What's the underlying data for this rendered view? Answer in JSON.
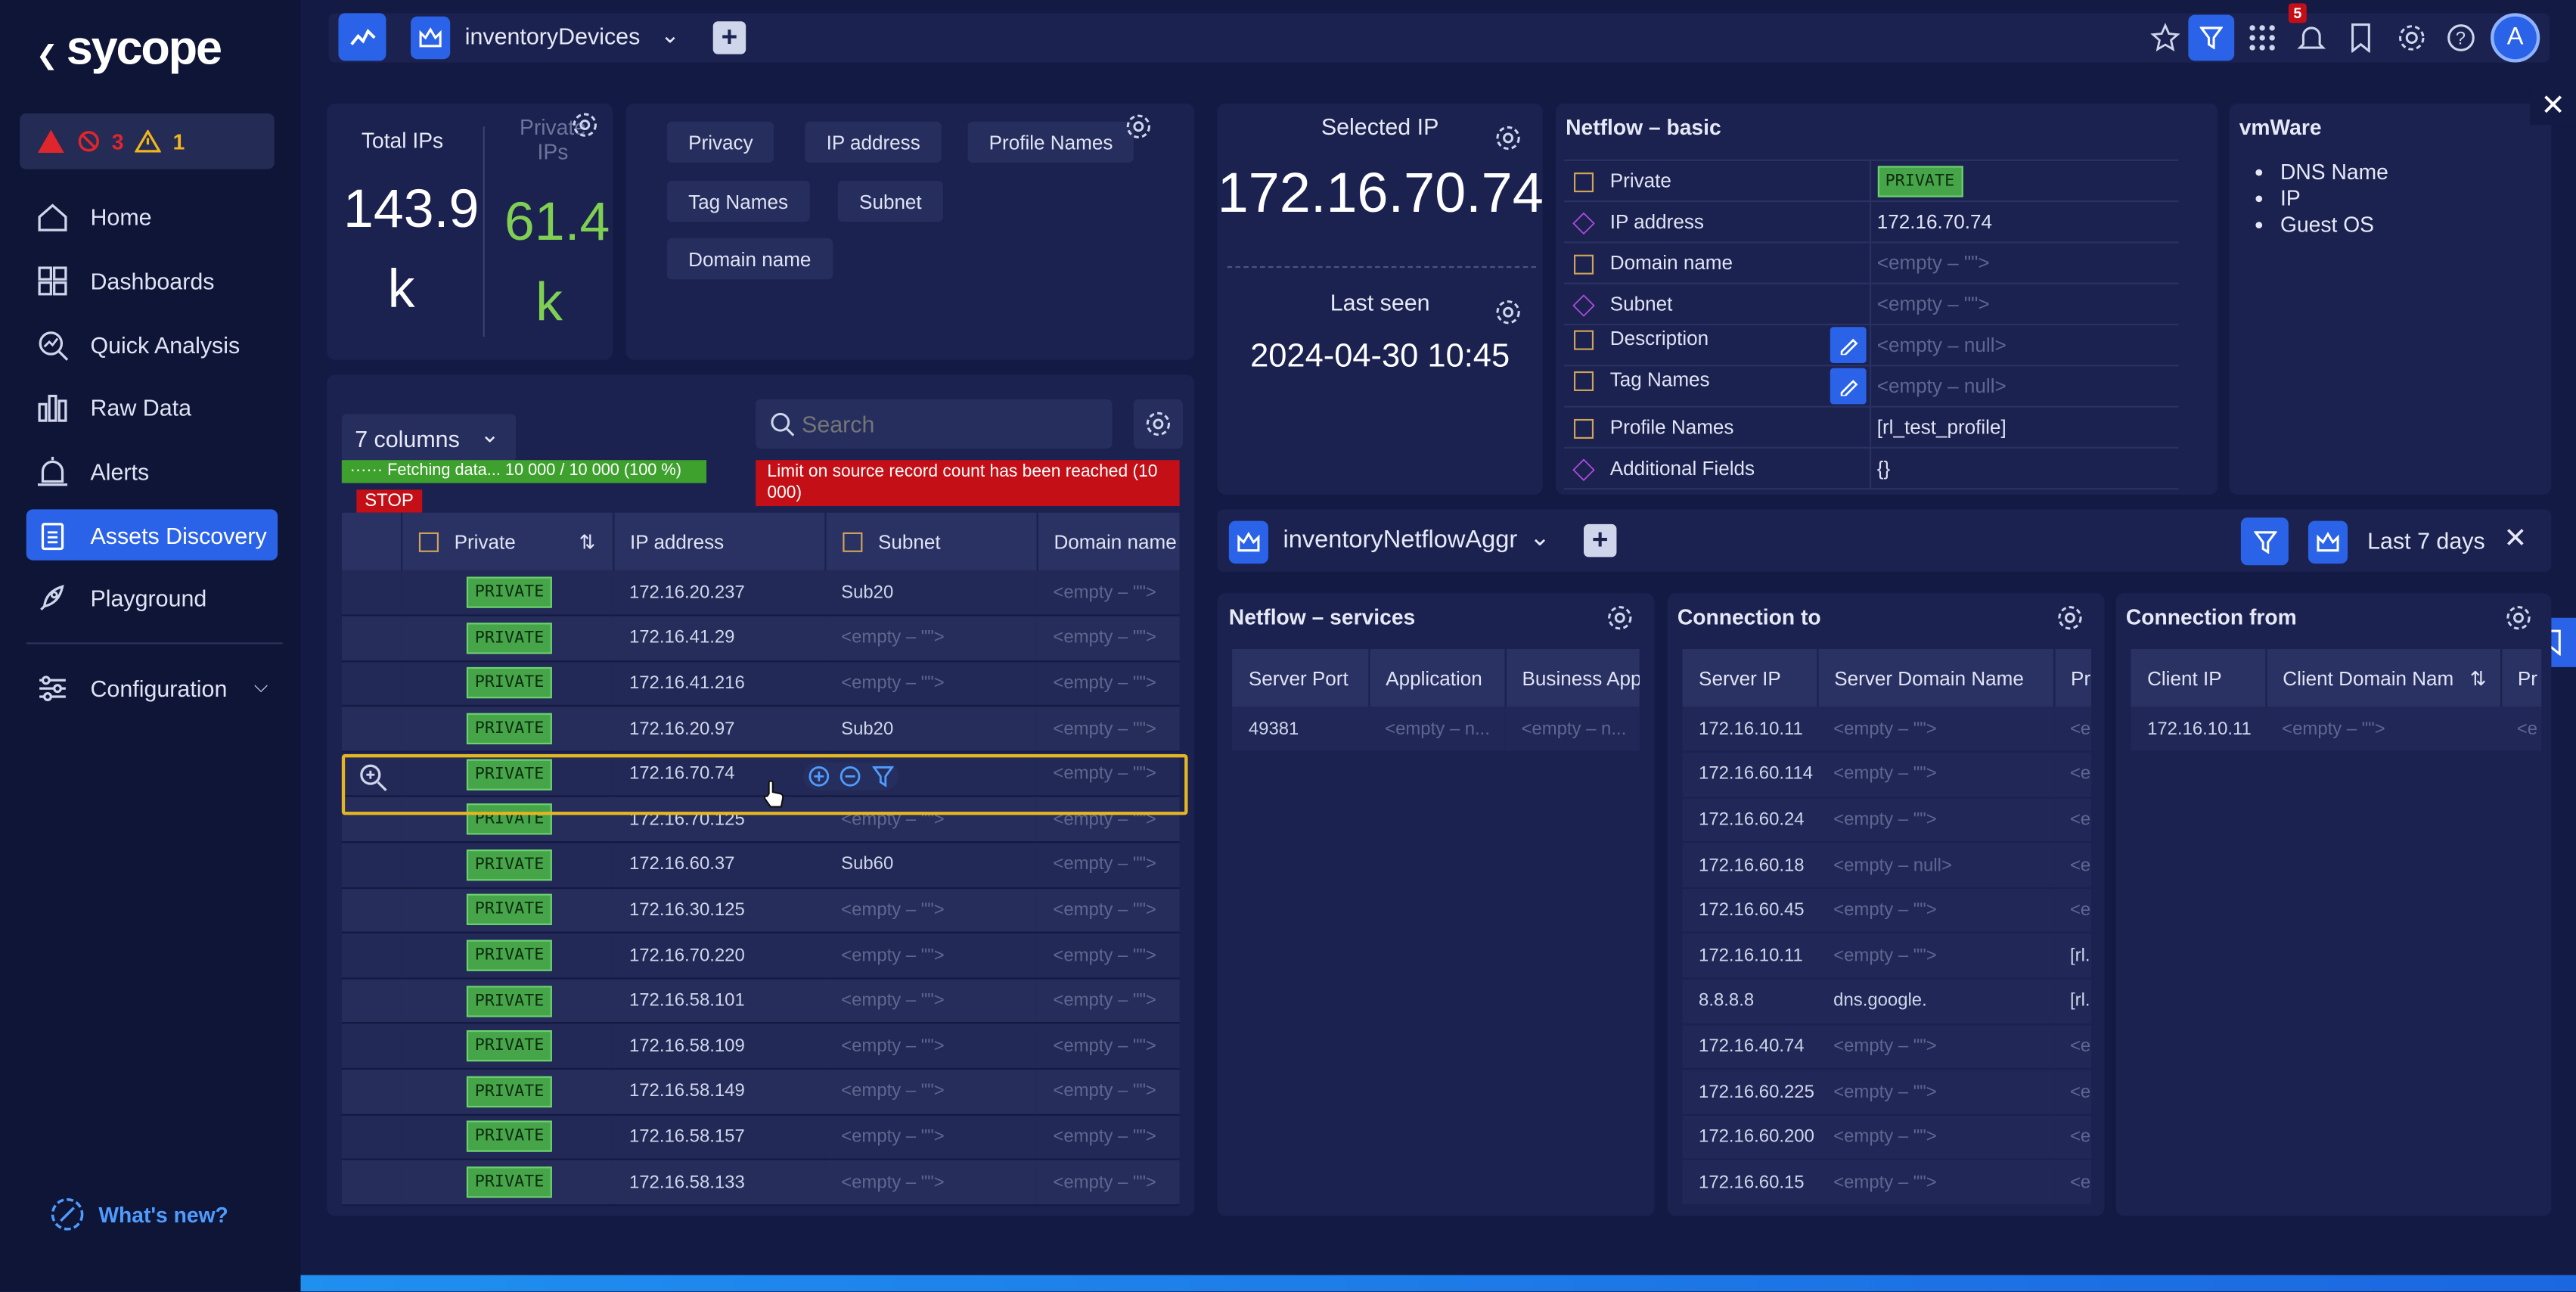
{
  "sidebar": {
    "logo": "sycope",
    "alerts": {
      "critical": "3",
      "warning": "1"
    },
    "nav": [
      {
        "label": "Home",
        "icon": "home-icon"
      },
      {
        "label": "Dashboards",
        "icon": "dashboards-icon"
      },
      {
        "label": "Quick Analysis",
        "icon": "quick-analysis-icon"
      },
      {
        "label": "Raw Data",
        "icon": "raw-data-icon"
      },
      {
        "label": "Alerts",
        "icon": "alerts-icon"
      },
      {
        "label": "Assets Discovery",
        "icon": "assets-icon",
        "active": true
      },
      {
        "label": "Playground",
        "icon": "rocket-icon"
      }
    ],
    "configuration": "Configuration",
    "whats_new": "What's new?"
  },
  "topbar": {
    "dataset": "inventoryDevices",
    "notifications": "5",
    "avatar": "A"
  },
  "stats": {
    "total_label": "Total IPs",
    "total_value": "143.9",
    "total_unit": "k",
    "private_label": "Private IPs",
    "private_value": "61.4",
    "private_unit": "k"
  },
  "filters": [
    "Privacy",
    "IP address",
    "Profile Names",
    "Tag Names",
    "Subnet",
    "Domain name"
  ],
  "table": {
    "columns_select": "7 columns",
    "fetching": "Fetching data... 10 000 / 10 000 (100 %)",
    "stop": "STOP",
    "limit_msg": "Limit on source record count has been reached (10 000)",
    "search_placeholder": "Search",
    "headers": [
      "Private",
      "IP address",
      "Subnet",
      "Domain name"
    ],
    "rows": [
      {
        "private": "PRIVATE",
        "ip": "172.16.20.237",
        "subnet": "Sub20",
        "domain": "<empty – \"\">"
      },
      {
        "private": "PRIVATE",
        "ip": "172.16.41.29",
        "subnet": "<empty – \"\">",
        "domain": "<empty – \"\">"
      },
      {
        "private": "PRIVATE",
        "ip": "172.16.41.216",
        "subnet": "<empty – \"\">",
        "domain": "<empty – \"\">"
      },
      {
        "private": "PRIVATE",
        "ip": "172.16.20.97",
        "subnet": "Sub20",
        "domain": "<empty – \"\">"
      },
      {
        "private": "PRIVATE",
        "ip": "172.16.70.74",
        "subnet": "– \"\">",
        "domain": "<empty – \"\">"
      },
      {
        "private": "PRIVATE",
        "ip": "172.16.70.125",
        "subnet": "<empty – \"\">",
        "domain": "<empty – \"\">"
      },
      {
        "private": "PRIVATE",
        "ip": "172.16.60.37",
        "subnet": "Sub60",
        "domain": "<empty – \"\">"
      },
      {
        "private": "PRIVATE",
        "ip": "172.16.30.125",
        "subnet": "<empty – \"\">",
        "domain": "<empty – \"\">"
      },
      {
        "private": "PRIVATE",
        "ip": "172.16.70.220",
        "subnet": "<empty – \"\">",
        "domain": "<empty – \"\">"
      },
      {
        "private": "PRIVATE",
        "ip": "172.16.58.101",
        "subnet": "<empty – \"\">",
        "domain": "<empty – \"\">"
      },
      {
        "private": "PRIVATE",
        "ip": "172.16.58.109",
        "subnet": "<empty – \"\">",
        "domain": "<empty – \"\">"
      },
      {
        "private": "PRIVATE",
        "ip": "172.16.58.149",
        "subnet": "<empty – \"\">",
        "domain": "<empty – \"\">"
      },
      {
        "private": "PRIVATE",
        "ip": "172.16.58.157",
        "subnet": "<empty – \"\">",
        "domain": "<empty – \"\">"
      },
      {
        "private": "PRIVATE",
        "ip": "172.16.58.133",
        "subnet": "<empty – \"\">",
        "domain": "<empty – \"\">"
      }
    ]
  },
  "selected": {
    "label": "Selected IP",
    "ip": "172.16.70.74",
    "last_seen_label": "Last seen",
    "last_seen": "2024-04-30 10:45"
  },
  "netflow_basic": {
    "title": "Netflow – basic",
    "rows": [
      {
        "key": "Private",
        "value": "PRIVATE",
        "badge": true
      },
      {
        "key": "IP address",
        "value": "172.16.70.74"
      },
      {
        "key": "Domain name",
        "value": "<empty – \"\">"
      },
      {
        "key": "Subnet",
        "value": "<empty – \"\">"
      },
      {
        "key": "Description",
        "value": "<empty – null>",
        "edit": true
      },
      {
        "key": "Tag Names",
        "value": "<empty – null>",
        "edit": true
      },
      {
        "key": "Profile Names",
        "value": "[rl_test_profile]"
      },
      {
        "key": "Additional Fields",
        "value": "{}"
      }
    ]
  },
  "vmware": {
    "title": "vmWare",
    "items": [
      "DNS Name",
      "IP",
      "Guest OS"
    ]
  },
  "subbar": {
    "dataset": "inventoryNetflowAggr",
    "range": "Last 7 days"
  },
  "services": {
    "title": "Netflow – services",
    "headers": [
      "Server Port",
      "Application",
      "Business App"
    ],
    "rows": [
      [
        "49381",
        "<empty – n...",
        "<empty – n..."
      ]
    ]
  },
  "conn_to": {
    "title": "Connection to",
    "headers": [
      "Server IP",
      "Server Domain Name",
      "Pr"
    ],
    "rows": [
      [
        "172.16.10.11",
        "<empty – \"\">",
        "<e"
      ],
      [
        "172.16.60.114",
        "<empty – \"\">",
        "<e"
      ],
      [
        "172.16.60.24",
        "<empty – \"\">",
        "<e"
      ],
      [
        "172.16.60.18",
        "<empty – null>",
        "<e"
      ],
      [
        "172.16.60.45",
        "<empty – \"\">",
        "<e"
      ],
      [
        "172.16.10.11",
        "<empty – \"\">",
        "[rl."
      ],
      [
        "8.8.8.8",
        "dns.google.",
        "[rl."
      ],
      [
        "172.16.40.74",
        "<empty – \"\">",
        "<e"
      ],
      [
        "172.16.60.225",
        "<empty – \"\">",
        "<e"
      ],
      [
        "172.16.60.200",
        "<empty – \"\">",
        "<e"
      ],
      [
        "172.16.60.15",
        "<empty – \"\">",
        "<e"
      ]
    ]
  },
  "conn_from": {
    "title": "Connection from",
    "headers": [
      "Client IP",
      "Client Domain Nam",
      "Pr"
    ],
    "rows": [
      [
        "172.16.10.11",
        "<empty – \"\">",
        "<e"
      ]
    ]
  },
  "colors": {
    "accent": "#2b63e8",
    "private_green": "#45a548",
    "highlight": "#e5b623",
    "danger": "#c40f16"
  }
}
